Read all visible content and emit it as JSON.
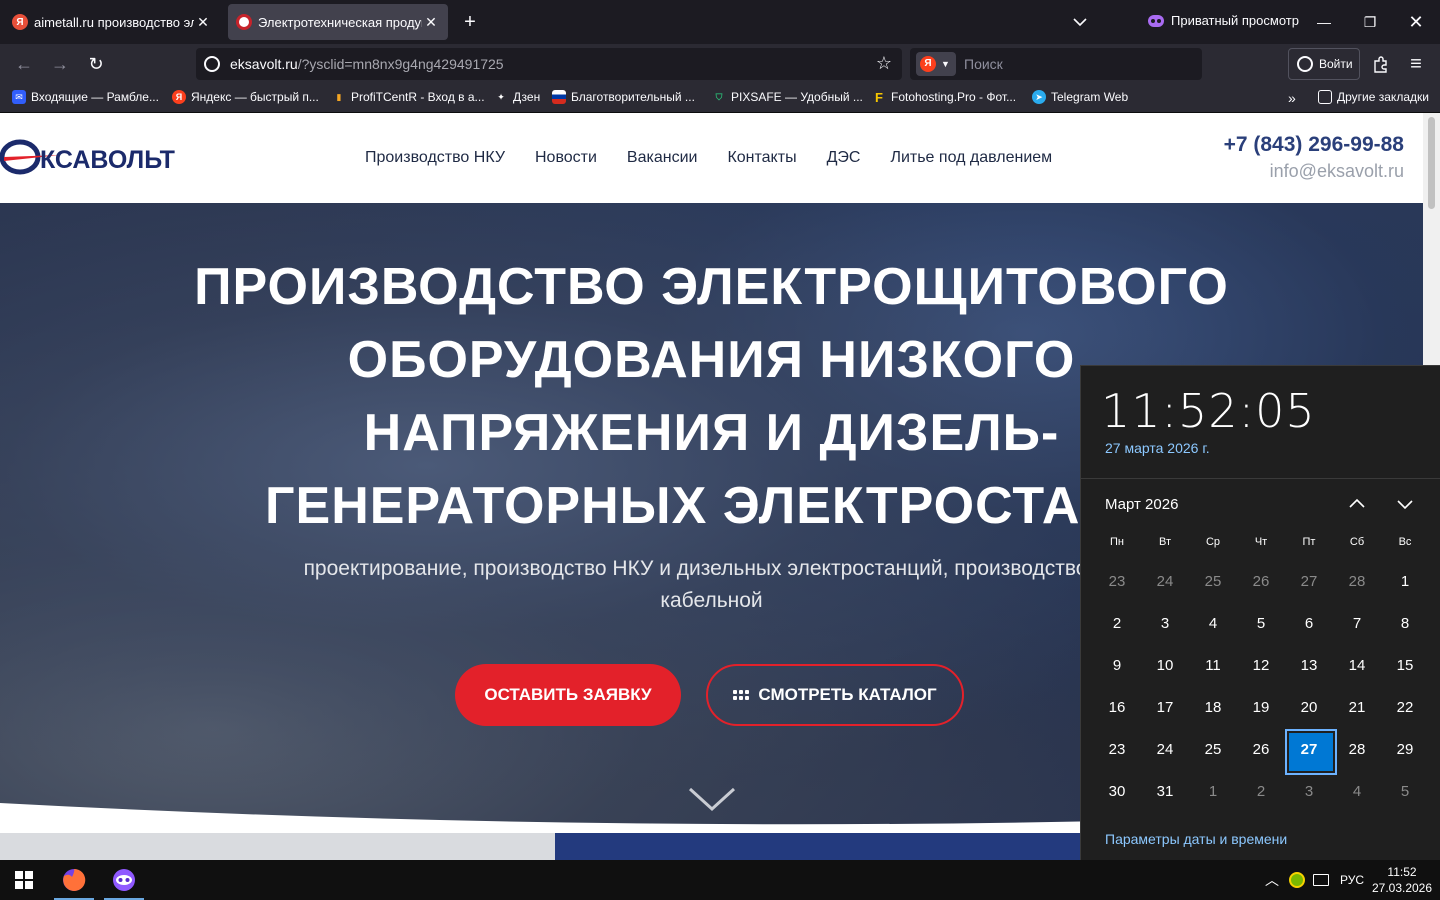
{
  "browser": {
    "tabs": [
      {
        "title": "aimetall.ru производство элект",
        "active": false
      },
      {
        "title": "Электротехническая продукци",
        "active": true
      }
    ],
    "private_label": "Приватный просмотр",
    "url_host": "eksavolt.ru",
    "url_rest": "/?ysclid=mn8nx9g4ng429491725",
    "search_placeholder": "Поиск",
    "signin_label": "Войти",
    "bookmarks": [
      {
        "label": "Входящие — Рамбле...",
        "icon": "mail-icon",
        "color": "#315efb"
      },
      {
        "label": "Яндекс — быстрый п...",
        "icon": "yandex-icon",
        "color": "#fc3f1d"
      },
      {
        "label": "ProfiTCentR - Вход в а...",
        "icon": "bar-chart-icon",
        "color": "#f5a623"
      },
      {
        "label": "Дзен",
        "icon": "sparkle-icon",
        "color": "#ffffff"
      },
      {
        "label": "Благотворительный ...",
        "icon": "flag-icon",
        "color": "#d52b1e"
      },
      {
        "label": "PIXSAFE — Удобный ...",
        "icon": "shield-icon",
        "color": "#2bb673"
      },
      {
        "label": "Fotohosting.Pro - Фот...",
        "icon": "f-letter-icon",
        "color": "#f7c600"
      },
      {
        "label": "Telegram Web",
        "icon": "telegram-icon",
        "color": "#2aabee"
      }
    ],
    "other_bookmarks": "Другие закладки"
  },
  "site": {
    "logo_text": "КСАВОЛЬТ",
    "nav": [
      "Производство НКУ",
      "Новости",
      "Вакансии",
      "Контакты",
      "ДЭС",
      "Литье под давлением"
    ],
    "phone": "+7 (843) 296-99-88",
    "email": "info@eksavolt.ru",
    "hero_title_lines": [
      "ПРОИЗВОДСТВО ЭЛЕКТРОЩИТОВОГО",
      "ОБОРУДОВАНИЯ НИЗКОГО",
      "НАПРЯЖЕНИЯ И ДИЗЕЛЬ-",
      "ГЕНЕРАТОРНЫХ ЭЛЕКТРОСТАНЦ"
    ],
    "hero_sub_lines": [
      "проектирование, производство НКУ и дизельных электростанций, производство ма",
      "кабельной"
    ],
    "btn_request": "ОСТАВИТЬ ЗАЯВКУ",
    "btn_catalog": "СМОТРЕТЬ КАТАЛОГ",
    "accent_color": "#e3212a"
  },
  "calendar": {
    "time": "11:52:05",
    "date_long": "27 марта 2026 г.",
    "month_label": "Март 2026",
    "weekdays": [
      "Пн",
      "Вт",
      "Ср",
      "Чт",
      "Пт",
      "Сб",
      "Вс"
    ],
    "days": [
      {
        "d": "23",
        "dim": true
      },
      {
        "d": "24",
        "dim": true
      },
      {
        "d": "25",
        "dim": true
      },
      {
        "d": "26",
        "dim": true
      },
      {
        "d": "27",
        "dim": true
      },
      {
        "d": "28",
        "dim": true
      },
      {
        "d": "1"
      },
      {
        "d": "2"
      },
      {
        "d": "3"
      },
      {
        "d": "4"
      },
      {
        "d": "5"
      },
      {
        "d": "6"
      },
      {
        "d": "7"
      },
      {
        "d": "8"
      },
      {
        "d": "9"
      },
      {
        "d": "10"
      },
      {
        "d": "11"
      },
      {
        "d": "12"
      },
      {
        "d": "13"
      },
      {
        "d": "14"
      },
      {
        "d": "15"
      },
      {
        "d": "16"
      },
      {
        "d": "17"
      },
      {
        "d": "18"
      },
      {
        "d": "19"
      },
      {
        "d": "20"
      },
      {
        "d": "21"
      },
      {
        "d": "22"
      },
      {
        "d": "23"
      },
      {
        "d": "24"
      },
      {
        "d": "25"
      },
      {
        "d": "26"
      },
      {
        "d": "27",
        "today": true
      },
      {
        "d": "28"
      },
      {
        "d": "29"
      },
      {
        "d": "30"
      },
      {
        "d": "31"
      },
      {
        "d": "1",
        "dim": true
      },
      {
        "d": "2",
        "dim": true
      },
      {
        "d": "3",
        "dim": true
      },
      {
        "d": "4",
        "dim": true
      },
      {
        "d": "5",
        "dim": true
      }
    ],
    "settings_link": "Параметры даты и времени"
  },
  "taskbar": {
    "language": "РУС",
    "time": "11:52",
    "date": "27.03.2026"
  }
}
